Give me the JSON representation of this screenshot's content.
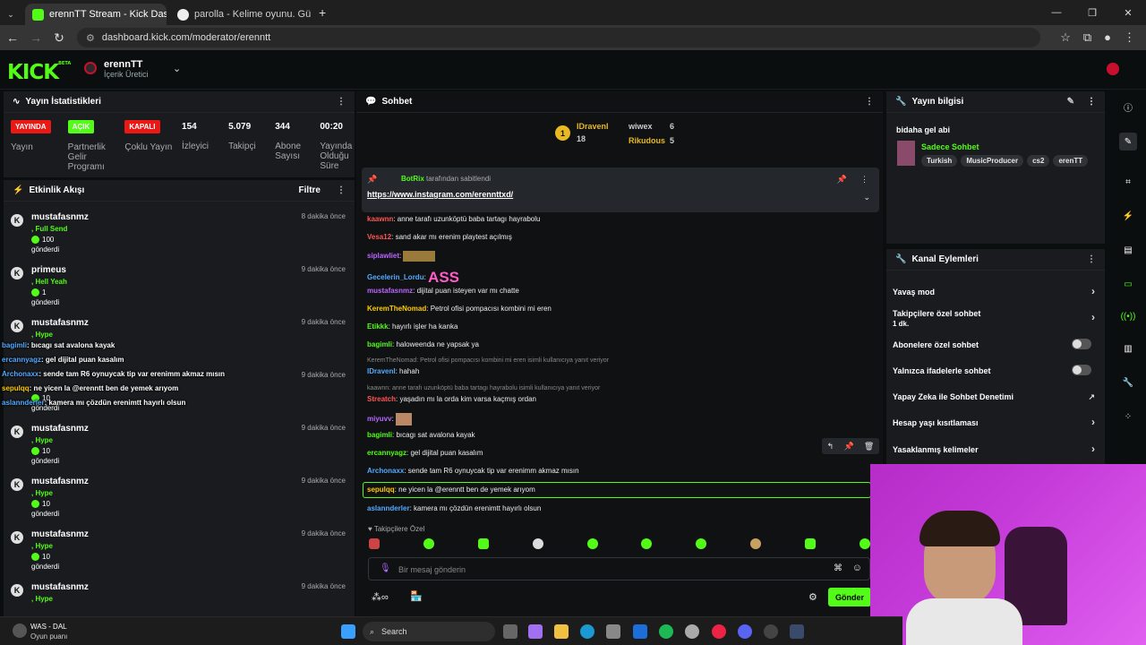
{
  "browser": {
    "tabs": [
      {
        "title": "erennTT Stream - Kick Dashbo...",
        "active": true
      },
      {
        "title": "parolla - Kelime oyunu. Günlük ...",
        "active": false
      }
    ],
    "url": "dashboard.kick.com/moderator/erenntt"
  },
  "header": {
    "logo": "KICK",
    "logo_badge": "BETA",
    "username": "erennTT",
    "role": "İçerik Üretici"
  },
  "stats_panel": {
    "title": "Yayın İstatistikleri",
    "items": [
      {
        "badge": "YAYINDA",
        "badge_color": "#e91916",
        "label": "Yayın"
      },
      {
        "badge": "AÇIK",
        "badge_color": "#53fc18",
        "label": "Partnerlik Gelir Programı"
      },
      {
        "badge": "KAPALI",
        "badge_color": "#e91916",
        "label": "Çoklu Yayın"
      },
      {
        "value": "154",
        "label": "İzleyici"
      },
      {
        "value": "5.079",
        "label": "Takipçi"
      },
      {
        "value": "344",
        "label": "Abone Sayısı"
      },
      {
        "value": "00:20",
        "label": "Yayında Olduğu Süre"
      }
    ]
  },
  "feed": {
    "title": "Etkinlik Akışı",
    "filter": "Filtre",
    "items": [
      {
        "name": "mustafasnmz",
        "type": ", Full Send",
        "amount": "100",
        "sent": "gönderdi",
        "time": "8 dakika önce"
      },
      {
        "name": "primeus",
        "type": ", Hell Yeah",
        "amount": "1",
        "sent": "gönderdi",
        "time": "9 dakika önce"
      },
      {
        "name": "mustafasnmz",
        "type": ", Hype",
        "amount": "10",
        "sent": "gönderdi",
        "time": "9 dakika önce"
      },
      {
        "name": "",
        "type": "",
        "amount": "10",
        "sent": "gönderdi",
        "time": "9 dakika önce"
      },
      {
        "name": "mustafasnmz",
        "type": ", Hype",
        "amount": "10",
        "sent": "gönderdi",
        "time": "9 dakika önce"
      },
      {
        "name": "mustafasnmz",
        "type": ", Hype",
        "amount": "10",
        "sent": "gönderdi",
        "time": "9 dakika önce"
      },
      {
        "name": "mustafasnmz",
        "type": ", Hype",
        "amount": "10",
        "sent": "gönderdi",
        "time": "9 dakika önce"
      },
      {
        "name": "mustafasnmz",
        "type": ", Hype",
        "amount": "10",
        "sent": "",
        "time": "9 dakika önce"
      }
    ],
    "overlay_chat": [
      {
        "user": "bagimli",
        "user_color": "#5af",
        "text": ": bıcagı sat avalona kayak"
      },
      {
        "user": "ercannyagz",
        "user_color": "#5af",
        "text": ": gel dijital puan kasalım"
      },
      {
        "user": "Archonaxx",
        "user_color": "#5af",
        "text": ": sende tam R6 oynuycak tip var erenimm akmaz mısın"
      },
      {
        "user": "sepulqq",
        "user_color": "#fc0",
        "text": ": ne yicen la @erenntt ben de yemek arıyom"
      },
      {
        "user": "aslannderler",
        "user_color": "#5af",
        "text": ": kamera mı çözdün erenimtt hayırlı olsun"
      }
    ]
  },
  "chat": {
    "title": "Sohbet",
    "leaderboard": [
      {
        "rank": "1",
        "name": "IDravenI",
        "count": "18"
      },
      {
        "name": "wiwex",
        "count": "6"
      },
      {
        "name": "Rikudous",
        "count": "5"
      }
    ],
    "pinned": {
      "by": "BotRix",
      "by_suffix": " tarafından sabitlendi",
      "link": "https://www.instagram.com/erennttxd/"
    },
    "messages": [
      {
        "user": "kaawnn",
        "color": "#f55",
        "text": ": anne tarafı uzunköptü baba tartagı hayrabolu"
      },
      {
        "user": "Vesa12",
        "color": "#f55",
        "text": ": sand akar mı erenim playtest açılmış"
      },
      {
        "user": "siplawliet",
        "color": "#b6f",
        "text": ":"
      },
      {
        "user": "Gecelerin_Lordu",
        "color": "#5af",
        "text": ":",
        "emote": "ASS"
      },
      {
        "user": "mustafasnmz",
        "color": "#b6f",
        "text": ": dijital puan isteyen var mı chatte"
      },
      {
        "user": "KeremTheNomad",
        "color": "#fc0",
        "text": ": Petrol ofisi pompacısı kombini mi eren"
      },
      {
        "user": "Etikkk",
        "color": "#53fc18",
        "text": ": hayırlı işler ha kanka"
      },
      {
        "user": "bagimli",
        "color": "#53fc18",
        "text": ": haloweenda ne yapsak ya"
      },
      {
        "reply": "KeremTheNomad: Petrol ofisi pompacısı kombini mi eren isimli kullanıcıya yanıt veriyor",
        "user": "IDravenI",
        "color": "#5af",
        "text": ": hahah"
      },
      {
        "reply": "kaawnn: anne tarafı uzunköptü baba tartagı hayrabolu isimli kullanıcıya yanıt veriyor",
        "user": "Streatch",
        "color": "#f55",
        "text": ": yaşadın mı la orda kim varsa kaçmış ordan"
      },
      {
        "user": "miyuvv",
        "color": "#b6f",
        "text": ":"
      },
      {
        "user": "bagimli",
        "color": "#53fc18",
        "text": ": bıcagı sat avalona kayak"
      },
      {
        "user": "ercannyagz",
        "color": "#53fc18",
        "text": ": gel dijital puan kasalım"
      },
      {
        "user": "Archonaxx",
        "color": "#5af",
        "text": ": sende tam R6 oynuycak tip var erenimm akmaz mısın"
      },
      {
        "user": "sepulqq",
        "color": "#fc0",
        "text": ": ne yicen la @erenntt ben de yemek arıyom"
      },
      {
        "user": "aslannderler",
        "color": "#5af",
        "text": ": kamera mı çözdün erenimtt hayırlı olsun"
      }
    ],
    "followers_only": "Takipçilere Özel",
    "input_placeholder": "Bir mesaj gönderin",
    "send": "Gönder"
  },
  "stream_info": {
    "title": "Yayın bilgisi",
    "stream_title": "bidaha gel abi",
    "category": "Sadece Sohbet",
    "tags": [
      "Turkish",
      "MusicProducer",
      "cs2",
      "erenTT"
    ]
  },
  "channel_actions": {
    "title": "Kanal Eylemleri",
    "items": [
      {
        "label": "Yavaş mod",
        "control": "arrow"
      },
      {
        "label": "Takipçilere özel sohbet",
        "sub": "1 dk.",
        "control": "arrow"
      },
      {
        "label": "Abonelere özel sohbet",
        "control": "toggle"
      },
      {
        "label": "Yalnızca ifadelerle sohbet",
        "control": "toggle"
      },
      {
        "label": "Yapay Zeka ile Sohbet Denetimi",
        "control": "external"
      },
      {
        "label": "Hesap yaşı kısıtlaması",
        "control": "arrow"
      },
      {
        "label": "Yasaklanmış kelimeler",
        "control": "arrow"
      }
    ]
  },
  "taskbar": {
    "music_title": "WAS - DAL",
    "music_sub": "Oyun puanı",
    "search": "Search"
  }
}
